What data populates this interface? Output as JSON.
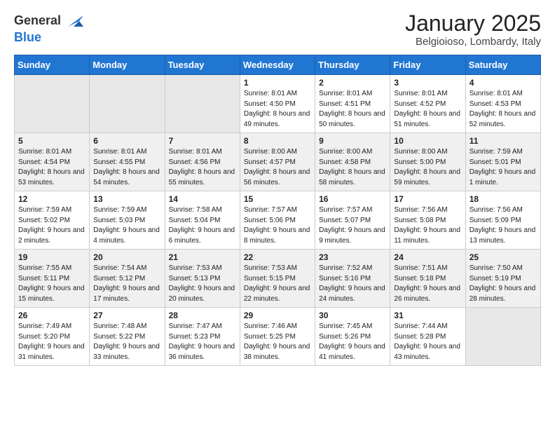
{
  "header": {
    "logo_general": "General",
    "logo_blue": "Blue",
    "cal_title": "January 2025",
    "cal_subtitle": "Belgioioso, Lombardy, Italy"
  },
  "weekdays": [
    "Sunday",
    "Monday",
    "Tuesday",
    "Wednesday",
    "Thursday",
    "Friday",
    "Saturday"
  ],
  "weeks": [
    [
      {
        "day": "",
        "info": ""
      },
      {
        "day": "",
        "info": ""
      },
      {
        "day": "",
        "info": ""
      },
      {
        "day": "1",
        "info": "Sunrise: 8:01 AM\nSunset: 4:50 PM\nDaylight: 8 hours and 49 minutes."
      },
      {
        "day": "2",
        "info": "Sunrise: 8:01 AM\nSunset: 4:51 PM\nDaylight: 8 hours and 50 minutes."
      },
      {
        "day": "3",
        "info": "Sunrise: 8:01 AM\nSunset: 4:52 PM\nDaylight: 8 hours and 51 minutes."
      },
      {
        "day": "4",
        "info": "Sunrise: 8:01 AM\nSunset: 4:53 PM\nDaylight: 8 hours and 52 minutes."
      }
    ],
    [
      {
        "day": "5",
        "info": "Sunrise: 8:01 AM\nSunset: 4:54 PM\nDaylight: 8 hours and 53 minutes."
      },
      {
        "day": "6",
        "info": "Sunrise: 8:01 AM\nSunset: 4:55 PM\nDaylight: 8 hours and 54 minutes."
      },
      {
        "day": "7",
        "info": "Sunrise: 8:01 AM\nSunset: 4:56 PM\nDaylight: 8 hours and 55 minutes."
      },
      {
        "day": "8",
        "info": "Sunrise: 8:00 AM\nSunset: 4:57 PM\nDaylight: 8 hours and 56 minutes."
      },
      {
        "day": "9",
        "info": "Sunrise: 8:00 AM\nSunset: 4:58 PM\nDaylight: 8 hours and 58 minutes."
      },
      {
        "day": "10",
        "info": "Sunrise: 8:00 AM\nSunset: 5:00 PM\nDaylight: 8 hours and 59 minutes."
      },
      {
        "day": "11",
        "info": "Sunrise: 7:59 AM\nSunset: 5:01 PM\nDaylight: 9 hours and 1 minute."
      }
    ],
    [
      {
        "day": "12",
        "info": "Sunrise: 7:59 AM\nSunset: 5:02 PM\nDaylight: 9 hours and 2 minutes."
      },
      {
        "day": "13",
        "info": "Sunrise: 7:59 AM\nSunset: 5:03 PM\nDaylight: 9 hours and 4 minutes."
      },
      {
        "day": "14",
        "info": "Sunrise: 7:58 AM\nSunset: 5:04 PM\nDaylight: 9 hours and 6 minutes."
      },
      {
        "day": "15",
        "info": "Sunrise: 7:57 AM\nSunset: 5:06 PM\nDaylight: 9 hours and 8 minutes."
      },
      {
        "day": "16",
        "info": "Sunrise: 7:57 AM\nSunset: 5:07 PM\nDaylight: 9 hours and 9 minutes."
      },
      {
        "day": "17",
        "info": "Sunrise: 7:56 AM\nSunset: 5:08 PM\nDaylight: 9 hours and 11 minutes."
      },
      {
        "day": "18",
        "info": "Sunrise: 7:56 AM\nSunset: 5:09 PM\nDaylight: 9 hours and 13 minutes."
      }
    ],
    [
      {
        "day": "19",
        "info": "Sunrise: 7:55 AM\nSunset: 5:11 PM\nDaylight: 9 hours and 15 minutes."
      },
      {
        "day": "20",
        "info": "Sunrise: 7:54 AM\nSunset: 5:12 PM\nDaylight: 9 hours and 17 minutes."
      },
      {
        "day": "21",
        "info": "Sunrise: 7:53 AM\nSunset: 5:13 PM\nDaylight: 9 hours and 20 minutes."
      },
      {
        "day": "22",
        "info": "Sunrise: 7:53 AM\nSunset: 5:15 PM\nDaylight: 9 hours and 22 minutes."
      },
      {
        "day": "23",
        "info": "Sunrise: 7:52 AM\nSunset: 5:16 PM\nDaylight: 9 hours and 24 minutes."
      },
      {
        "day": "24",
        "info": "Sunrise: 7:51 AM\nSunset: 5:18 PM\nDaylight: 9 hours and 26 minutes."
      },
      {
        "day": "25",
        "info": "Sunrise: 7:50 AM\nSunset: 5:19 PM\nDaylight: 9 hours and 28 minutes."
      }
    ],
    [
      {
        "day": "26",
        "info": "Sunrise: 7:49 AM\nSunset: 5:20 PM\nDaylight: 9 hours and 31 minutes."
      },
      {
        "day": "27",
        "info": "Sunrise: 7:48 AM\nSunset: 5:22 PM\nDaylight: 9 hours and 33 minutes."
      },
      {
        "day": "28",
        "info": "Sunrise: 7:47 AM\nSunset: 5:23 PM\nDaylight: 9 hours and 36 minutes."
      },
      {
        "day": "29",
        "info": "Sunrise: 7:46 AM\nSunset: 5:25 PM\nDaylight: 9 hours and 38 minutes."
      },
      {
        "day": "30",
        "info": "Sunrise: 7:45 AM\nSunset: 5:26 PM\nDaylight: 9 hours and 41 minutes."
      },
      {
        "day": "31",
        "info": "Sunrise: 7:44 AM\nSunset: 5:28 PM\nDaylight: 9 hours and 43 minutes."
      },
      {
        "day": "",
        "info": ""
      }
    ]
  ]
}
